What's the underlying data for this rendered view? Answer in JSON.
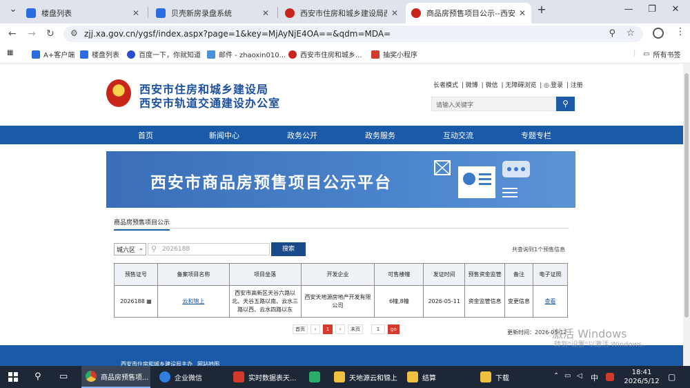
{
  "browser": {
    "tabs": [
      {
        "title": "楼盘列表",
        "icon": "blue"
      },
      {
        "title": "贝壳新房录盘系统",
        "icon": "blue"
      },
      {
        "title": "西安市住房和城乡建设局西安市",
        "icon": "red"
      },
      {
        "title": "商品房预售项目公示--西安市住",
        "icon": "red"
      }
    ],
    "url": "zjj.xa.gov.cn/ygsf/index.aspx?page=1&key=MjAyNjE4OA==&qdm=MDA=",
    "bookmarks": [
      "A+客户端",
      "楼盘列表",
      "百度一下，你就知道",
      "邮件 - zhaoxin010...",
      "西安市住房和城乡...",
      "抽奖小程序"
    ],
    "all_bookmarks": "所有书签"
  },
  "site": {
    "title_line1": "西安市住房和城乡建设局",
    "title_line2": "西安市轨道交通建设办公室",
    "top_links": [
      "长者模式",
      "微博",
      "微信",
      "无障碍浏览",
      "登录",
      "注册"
    ],
    "search_placeholder": "请输入关键字",
    "nav": [
      "首页",
      "新闻中心",
      "政务公开",
      "政务服务",
      "互动交流",
      "专题专栏"
    ],
    "banner_title": "西安市商品房预售项目公示平台"
  },
  "main": {
    "tab_label": "商品房预售项目公示",
    "district": "城六区",
    "query_value": "2026188",
    "search_label": "搜索",
    "found_text": "共查询到1个预售信息",
    "columns": [
      "预售证号",
      "备案项目名称",
      "项目坐落",
      "开发企业",
      "可售楼幢",
      "发证时间",
      "预售资金监管",
      "备注",
      "电子证照"
    ],
    "rows": [
      {
        "cert_no": "2026188",
        "project": "云和锦上",
        "location": "西安市高新区天谷六路以北、天谷五路以南、云水三路以西、云水四路以东",
        "developer": "西安天地源房地产开发有限公司",
        "buildings": "6幢,8幢",
        "issue_date": "2026-05-11",
        "fund": "资金监管信息",
        "remark": "变更信息",
        "license": "查看"
      }
    ],
    "pager": {
      "first": "首页",
      "prev": "‹",
      "current": "1",
      "next": "›",
      "last": "末页",
      "goto_value": "1",
      "go": "go"
    },
    "updated": "更新时间：2026-05-12"
  },
  "footer": {
    "links": [
      "西安市住房和城乡建设局主办",
      "网站地图"
    ]
  },
  "watermark": {
    "line1": "激活 Windows",
    "line2": "转到\"设置\"以激活 Windows。"
  },
  "taskbar": {
    "apps": [
      {
        "label": "商品房预售项...",
        "color": "#e8a33c"
      },
      {
        "label": "企业微信",
        "color": "#2f7ee0"
      },
      {
        "label": "实时数据表天...",
        "color": "#d33a2c"
      },
      {
        "label": "",
        "color": "#2aae67"
      },
      {
        "label": "天地源云和锦上",
        "color": "#f0c040"
      },
      {
        "label": "结算",
        "color": "#f0c040"
      },
      {
        "label": "下载",
        "color": "#f0c040"
      }
    ],
    "ime": "中",
    "time": "18:41",
    "date": "2026/5/12"
  }
}
